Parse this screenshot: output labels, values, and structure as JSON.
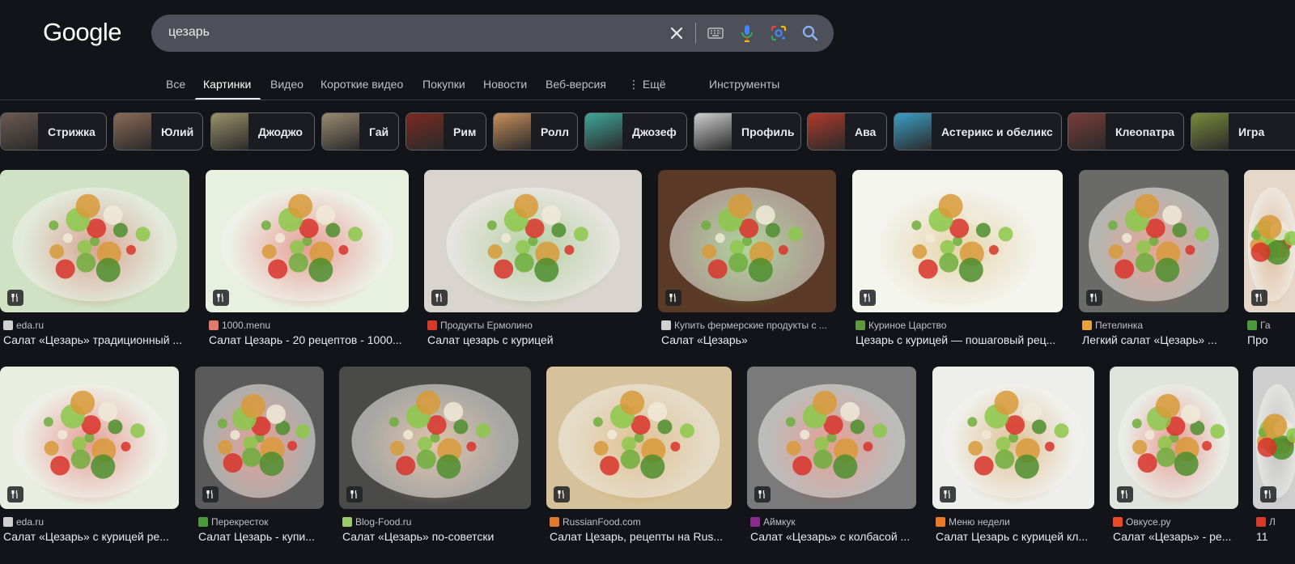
{
  "header": {
    "logo": "Google",
    "search_value": "цезарь"
  },
  "tabs": [
    {
      "label": "Все"
    },
    {
      "label": "Картинки",
      "active": true
    },
    {
      "label": "Видео"
    },
    {
      "label": "Короткие видео"
    },
    {
      "label": "Покупки"
    },
    {
      "label": "Новости"
    },
    {
      "label": "Веб-версия"
    },
    {
      "label": "⋮ Ещё"
    },
    {
      "label": "Инструменты"
    }
  ],
  "chips": [
    {
      "label": "Стрижка",
      "thumb": "#6b5a52"
    },
    {
      "label": "Юлий",
      "thumb": "#8a6a56"
    },
    {
      "label": "Джоджо",
      "thumb": "#9b9169"
    },
    {
      "label": "Гай",
      "thumb": "#9a8b72"
    },
    {
      "label": "Рим",
      "thumb": "#7a2a20"
    },
    {
      "label": "Ролл",
      "thumb": "#c98f5b"
    },
    {
      "label": "Джозеф",
      "thumb": "#3fa79a"
    },
    {
      "label": "Профиль",
      "thumb": "#cfcfcf"
    },
    {
      "label": "Ава",
      "thumb": "#b03a2a"
    },
    {
      "label": "Астерикс и обеликс",
      "thumb": "#3a9fc4"
    },
    {
      "label": "Клеопатра",
      "thumb": "#7a3d38"
    },
    {
      "label": "Игра",
      "thumb": "#7b8a3a"
    }
  ],
  "results": [
    {
      "source": "eda.ru",
      "title": "Салат «Цезарь» традиционный ...",
      "fav": "#d0d0d0",
      "color": "#cfe2c4",
      "accent": "#b84a2a"
    },
    {
      "source": "1000.menu",
      "title": "Салат Цезарь - 20 рецептов - 1000...",
      "fav": "#e07a6a",
      "color": "#e8f0e0",
      "accent": "#d63a2a"
    },
    {
      "source": "Продукты Ермолино",
      "title": "Салат цезарь с курицей",
      "fav": "#d63a2a",
      "color": "#d9d4cd",
      "accent": "#6ea84a"
    },
    {
      "source": "Купить фермерские продукты с ...",
      "title": "Салат «Цезарь»",
      "fav": "#d0d0d0",
      "color": "#5a3a26",
      "accent": "#5fae3a"
    },
    {
      "source": "Куриное Царство",
      "title": "Цезарь с курицей — пошаговый рец...",
      "fav": "#5c9a3c",
      "color": "#f4f6ee",
      "accent": "#d8b25a"
    },
    {
      "source": "Петелинка",
      "title": "Легкий салат «Цезарь» ...",
      "fav": "#e8a23a",
      "color": "#6a6a66",
      "accent": "#d84a2a"
    },
    {
      "source": "Га",
      "title": "Про",
      "fav": "#4a9a3a",
      "color": "#e6d8c8",
      "accent": "#c87a3a"
    },
    {
      "source": "eda.ru",
      "title": "Салат «Цезарь» с курицей ре...",
      "fav": "#d0d0d0",
      "color": "#e8eee0",
      "accent": "#d83a2a"
    },
    {
      "source": "Перекресток",
      "title": "Салат Цезарь - купи...",
      "fav": "#4a9a3a",
      "color": "#5a5a5a",
      "accent": "#d83a2a"
    },
    {
      "source": "Blog-Food.ru",
      "title": "Салат «Цезарь» по-советски",
      "fav": "#9aca6a",
      "color": "#4a4a48",
      "accent": "#c88a5a"
    },
    {
      "source": "RussianFood.com",
      "title": "Салат Цезарь, рецепты на Rus...",
      "fav": "#e07a2a",
      "color": "#d6c29a",
      "accent": "#c8862a"
    },
    {
      "source": "Аймкук",
      "title": "Салат «Цезарь» с колбасой ...",
      "fav": "#8a2a8a",
      "color": "#7a7a7a",
      "accent": "#d83a2a"
    },
    {
      "source": "Меню недели",
      "title": "Салат Цезарь с курицей кл...",
      "fav": "#e87a2a",
      "color": "#eeeeea",
      "accent": "#c8862a"
    },
    {
      "source": "Овкусе.ру",
      "title": "Салат «Цезарь» - ре...",
      "fav": "#e84a2a",
      "color": "#e0e4dc",
      "accent": "#d83a2a"
    },
    {
      "source": "Л",
      "title": "11",
      "fav": "#d83a2a",
      "color": "#cfcfcf",
      "accent": "#8a8a8a"
    }
  ]
}
